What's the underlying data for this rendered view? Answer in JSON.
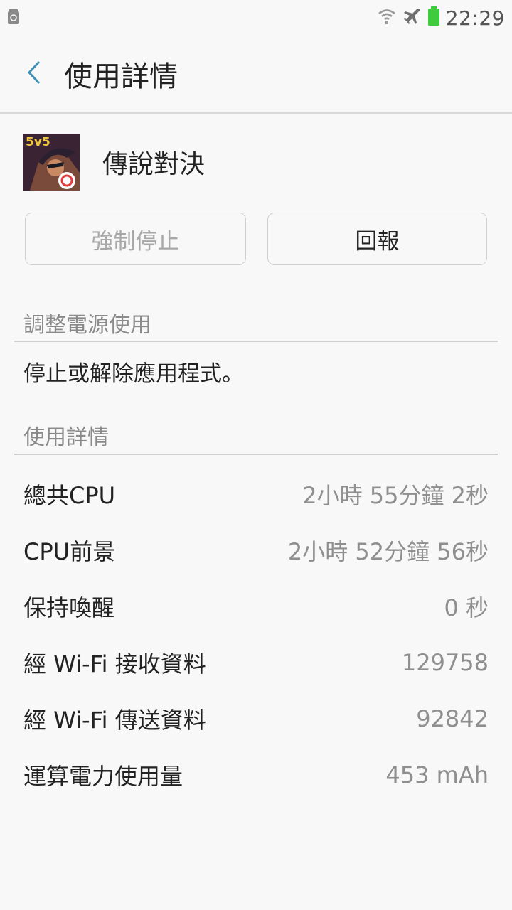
{
  "status_bar": {
    "left_icon": "recycle-icon",
    "icons": [
      "wifi-icon",
      "airplane-mode-icon",
      "battery-icon"
    ],
    "time": "22:29",
    "battery_color": "#3ecb3e"
  },
  "header": {
    "back_icon": "chevron-left-icon",
    "title": "使用詳情"
  },
  "app": {
    "name": "傳說對決",
    "icon_badge": "5v5"
  },
  "buttons": {
    "force_stop": "強制停止",
    "report": "回報"
  },
  "power_section": {
    "header": "調整電源使用",
    "text": "停止或解除應用程式。"
  },
  "usage_section": {
    "header": "使用詳情",
    "rows": [
      {
        "label": "總共CPU",
        "value": "2小時 55分鐘 2秒"
      },
      {
        "label": "CPU前景",
        "value": "2小時 52分鐘 56秒"
      },
      {
        "label": "保持喚醒",
        "value": "0 秒"
      },
      {
        "label": "經 Wi-Fi 接收資料",
        "value": "129758"
      },
      {
        "label": "經 Wi-Fi 傳送資料",
        "value": "92842"
      },
      {
        "label": "運算電力使用量",
        "value": "453 mAh"
      }
    ]
  },
  "colors": {
    "accent": "#3f8fb5",
    "background": "#f8f8f8",
    "secondary_text": "#8a8a8a"
  }
}
